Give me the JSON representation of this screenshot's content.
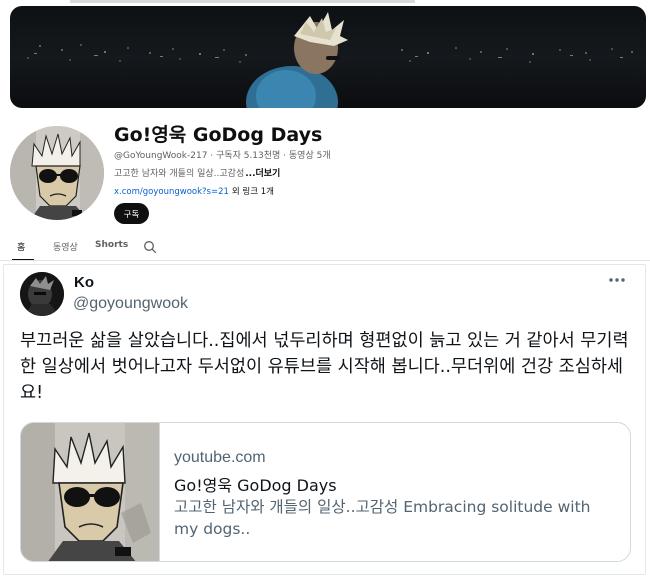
{
  "channel": {
    "title": "Go!영욱 GoDog Days",
    "meta": "@GoYoungWook-217 · 구독자 5.13천명 · 동영상 5개",
    "description": "고고한 남자와 개들의 일상..고감성",
    "more_label": "...더보기",
    "link_url": "x.com/goyoungwook?s=21",
    "link_extra": "외 링크 1개",
    "subscribe_label": "구독",
    "tabs": [
      "홈",
      "동영상",
      "Shorts"
    ]
  },
  "tweet": {
    "author_name": "Ko",
    "author_handle": "@goyoungwook",
    "text": "부끄러운 삶을 살았습니다..집에서 넋두리하며 형편없이 늙고 있는 거 같아서 무기력한 일상에서 벗어나고자 두서없이 유튜브를 시작해 봅니다..무더위에 건강 조심하세요!",
    "card": {
      "domain": "youtube.com",
      "title": "Go!영욱 GoDog Days",
      "description": "고고한 남자와 개들의 일상..고감성 Embracing solitude with my dogs.."
    }
  },
  "icons": {
    "search": "search-icon",
    "more": "more-horizontal-icon"
  },
  "colors": {
    "link_blue": "#065fd4",
    "subscribe_bg": "#0f0f0f",
    "tweet_secondary": "#536471"
  }
}
